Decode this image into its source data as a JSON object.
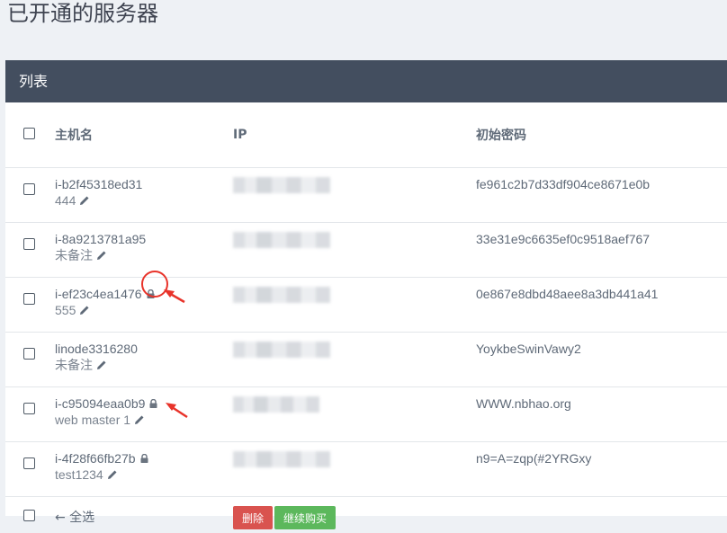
{
  "page": {
    "title": "已开通的服务器"
  },
  "panel": {
    "title": "列表"
  },
  "table": {
    "headers": {
      "hostname": "主机名",
      "ip": "IP",
      "password": "初始密码"
    },
    "rows": [
      {
        "hostname": "i-b2f45318ed31",
        "remark": "444",
        "locked": false,
        "password": "fe961c2b7d33df904ce8671e0b"
      },
      {
        "hostname": "i-8a9213781a95",
        "remark": "未备注",
        "locked": false,
        "password": "33e31e9c6635ef0c9518aef767"
      },
      {
        "hostname": "i-ef23c4ea1476",
        "remark": "555",
        "locked": true,
        "password": "0e867e8dbd48aee8a3db441a41"
      },
      {
        "hostname": "linode3316280",
        "remark": "未备注",
        "locked": false,
        "password": "YoykbeSwinVawy2"
      },
      {
        "hostname": "i-c95094eaa0b9",
        "remark": "web master 1",
        "locked": true,
        "password": "WWW.nbhao.org"
      },
      {
        "hostname": "i-4f28f66fb27b",
        "remark": "test1234",
        "locked": true,
        "password": "n9=A=zqp(#2YRGxy"
      }
    ]
  },
  "footer": {
    "select_all_label": "← 全选",
    "delete_label": "删除",
    "renew_label": "继续购买"
  },
  "colors": {
    "header_bg": "#434e5f",
    "delete": "#d9534f",
    "renew": "#5cb85c",
    "annotation": "#e8332a"
  },
  "icons": {
    "lock": "lock-icon",
    "edit": "pencil-icon"
  }
}
